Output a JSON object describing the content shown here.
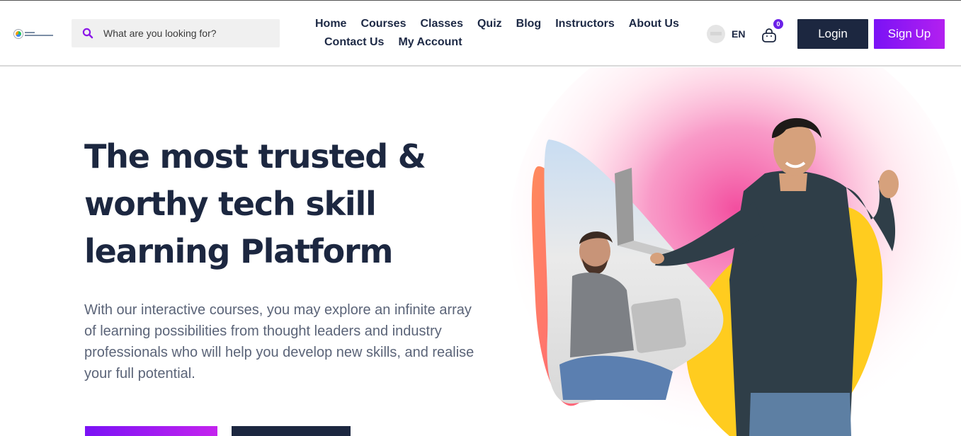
{
  "header": {
    "logo_name": "logo",
    "search": {
      "placeholder": "What are you looking for?",
      "icon": "search-icon"
    },
    "nav": {
      "row1": [
        "Home",
        "Courses",
        "Classes",
        "Quiz",
        "Blog",
        "Instructors",
        "About Us"
      ],
      "row2": [
        "Contact Us",
        "My Account"
      ]
    },
    "language": {
      "code": "EN",
      "icon": "flag-icon"
    },
    "cart": {
      "count": "0",
      "icon": "shopping-bag-icon"
    },
    "login_label": "Login",
    "signup_label": "Sign Up"
  },
  "hero": {
    "title": "The most trusted & worthy tech skill learning Platform",
    "description": "With our interactive courses, you may explore an infinite array of learning possibilities from thought leaders and industry professionals who will help you develop new skills, and realise your full potential."
  },
  "colors": {
    "navy": "#1c2740",
    "purple_start": "#7a12f5",
    "purple_end": "#b320f0",
    "badge": "#6b21e8",
    "pink_glow": "#f2459a",
    "yellow_blob": "#ffcc1f",
    "orange_blob": "#ff7b54"
  }
}
